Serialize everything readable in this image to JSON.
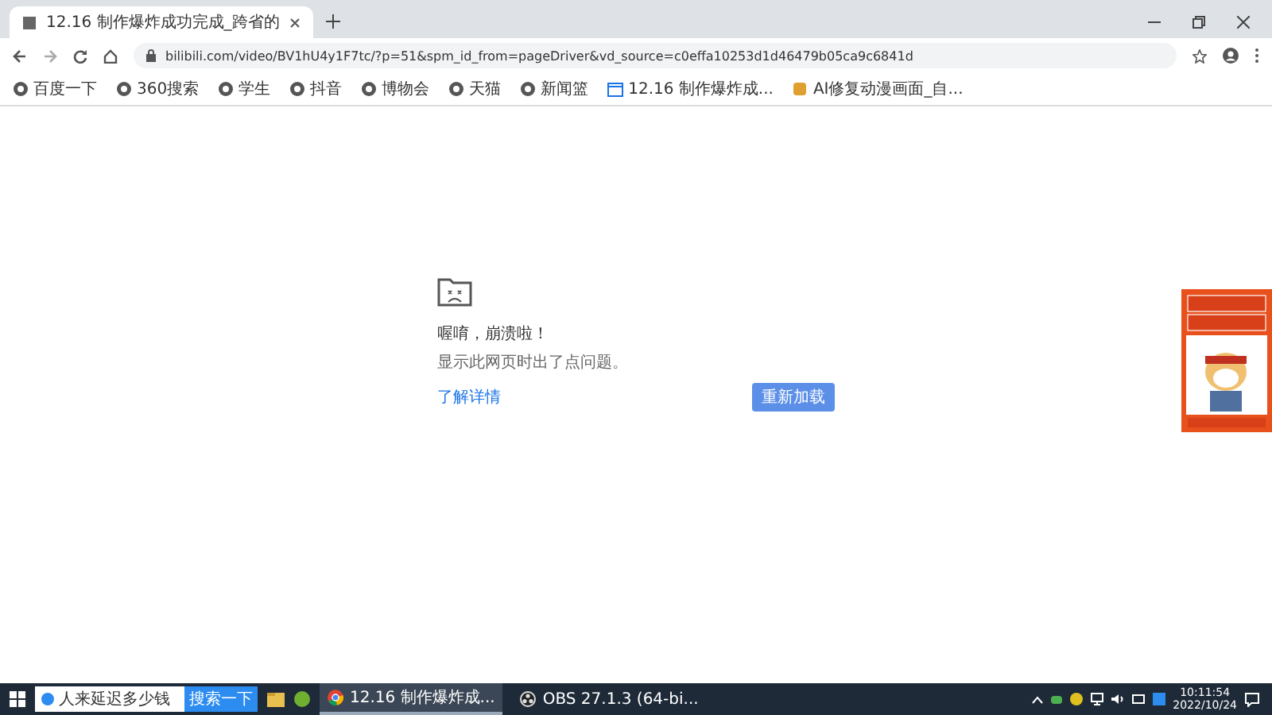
{
  "browser": {
    "tabs": [
      {
        "title": "12.16 制作爆炸成功完成_跨省的",
        "selected": true
      }
    ],
    "address": "bilibili.com/video/BV1hU4y1F7tc/?p=51&spm_id_from=pageDriver&vd_source=c0effa10253d1d46479b05ca9c6841d",
    "bookmarks": [
      {
        "label": "百度一下",
        "kind": "site"
      },
      {
        "label": "360搜索",
        "kind": "site"
      },
      {
        "label": "学生",
        "kind": "site"
      },
      {
        "label": "抖音",
        "kind": "site"
      },
      {
        "label": "博物会",
        "kind": "site"
      },
      {
        "label": "天猫",
        "kind": "site"
      },
      {
        "label": "新闻篮",
        "kind": "site"
      },
      {
        "label": "12.16 制作爆炸成...",
        "kind": "calendar"
      },
      {
        "label": "AI修复动漫画面_自...",
        "kind": "app"
      }
    ]
  },
  "error_page": {
    "title": "喔唷，崩溃啦！",
    "message": "显示此网页时出了点问题。",
    "link": "了解详情",
    "button": "重新加载"
  },
  "taskbar": {
    "search": {
      "value": "人来延迟多少钱",
      "button": "搜索一下"
    },
    "apps": [
      {
        "label": "12.16 制作爆炸成...",
        "kind": "chrome",
        "selected": true
      },
      {
        "label": "OBS 27.1.3 (64-bi...",
        "kind": "obs",
        "selected": false
      }
    ],
    "time": "10:11:54",
    "date": "2022/10/24"
  }
}
